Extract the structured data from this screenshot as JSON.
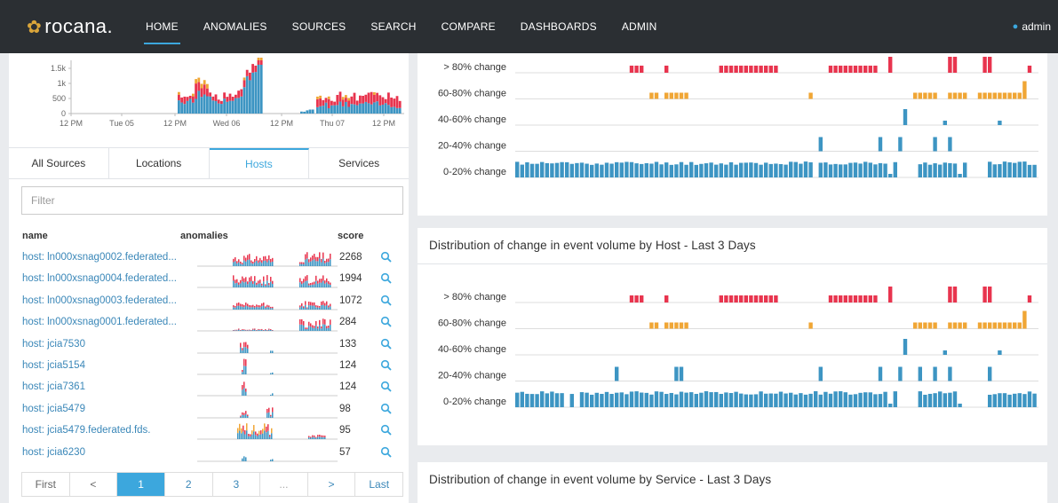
{
  "nav": {
    "logo": "rocana.",
    "items": [
      "HOME",
      "ANOMALIES",
      "SOURCES",
      "SEARCH",
      "COMPARE",
      "DASHBOARDS",
      "ADMIN"
    ],
    "active": "HOME",
    "user": "admin"
  },
  "timeline": {
    "y_ticks": [
      "1.5k",
      "1k",
      "500",
      "0"
    ],
    "x_ticks": [
      "12 PM",
      "Tue 05",
      "12 PM",
      "Wed 06",
      "12 PM",
      "Thu 07",
      "12 PM"
    ]
  },
  "tabs": [
    "All Sources",
    "Locations",
    "Hosts",
    "Services"
  ],
  "active_tab": "Hosts",
  "filter": {
    "placeholder": "Filter",
    "value": ""
  },
  "table": {
    "headers": {
      "name": "name",
      "anomalies": "anomalies",
      "score": "score"
    },
    "rows": [
      {
        "name": "host: ln000xsnag0002.federated...",
        "score": "2268"
      },
      {
        "name": "host: ln000xsnag0004.federated...",
        "score": "1994"
      },
      {
        "name": "host: ln000xsnag0003.federated...",
        "score": "1072"
      },
      {
        "name": "host: ln000xsnag0001.federated...",
        "score": "284"
      },
      {
        "name": "host: jcia7530",
        "score": "133"
      },
      {
        "name": "host: jcia5154",
        "score": "124"
      },
      {
        "name": "host: jcia7361",
        "score": "124"
      },
      {
        "name": "host: jcia5479",
        "score": "98"
      },
      {
        "name": "host: jcia5479.federated.fds.",
        "score": "95"
      },
      {
        "name": "host: jcia6230",
        "score": "57"
      }
    ]
  },
  "pager": {
    "first": "First",
    "prev": "<",
    "pages": [
      "1",
      "2",
      "3",
      "..."
    ],
    "next": ">",
    "last": "Last",
    "current": "1"
  },
  "panels": [
    {
      "title": "",
      "rows": [
        "> 80% change",
        "60-80% change",
        "40-60% change",
        "20-40% change",
        "0-20% change"
      ]
    },
    {
      "title": "Distribution of change in event volume by Host - Last 3 Days",
      "rows": [
        "> 80% change",
        "60-80% change",
        "40-60% change",
        "20-40% change",
        "0-20% change"
      ]
    },
    {
      "title": "Distribution of change in event volume by Service - Last 3 Days"
    }
  ],
  "colors": {
    "red": "#e8344e",
    "orange": "#f0a635",
    "blue": "#3d95c3",
    "accent": "#3ca7dd",
    "nav_bg": "#2b2f33"
  }
}
